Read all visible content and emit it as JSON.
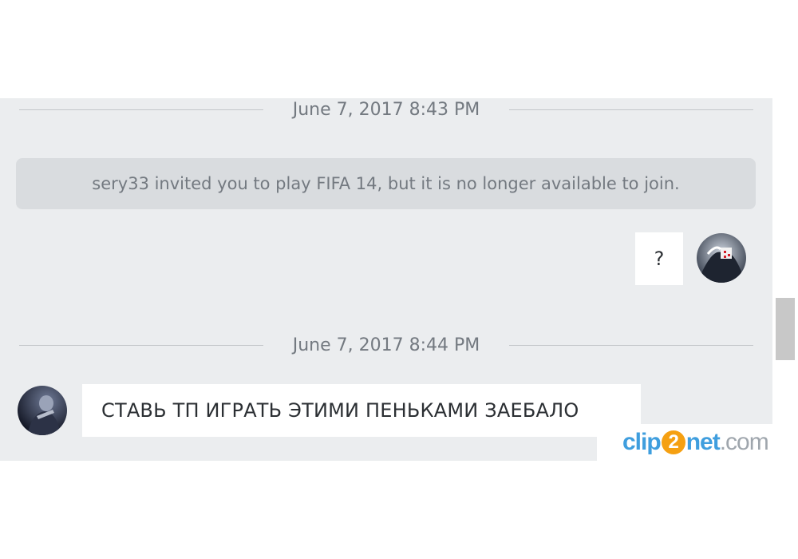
{
  "chat": {
    "separators": [
      {
        "date": "June 7, 2017 8:43 PM"
      },
      {
        "date": "June 7, 2017 8:44 PM"
      }
    ],
    "invite_notice": "sery33 invited you to play FIFA 14, but it is no longer available to join.",
    "messages": [
      {
        "direction": "outgoing",
        "text": "?"
      },
      {
        "direction": "incoming",
        "text": "СТАВЬ ТП ИГРАТЬ ЭТИМИ ПЕНЬКАМИ ЗАЕБАЛО"
      }
    ]
  },
  "watermark": {
    "part1": "clip",
    "digit": "2",
    "part2": "net",
    "suffix": ".com"
  },
  "colors": {
    "panel_bg": "#ebedef",
    "notice_bg": "#d9dcdf",
    "muted_text": "#737980",
    "message_text": "#2b2f33",
    "watermark_blue": "#3f9ede",
    "watermark_orange": "#f5a012"
  }
}
